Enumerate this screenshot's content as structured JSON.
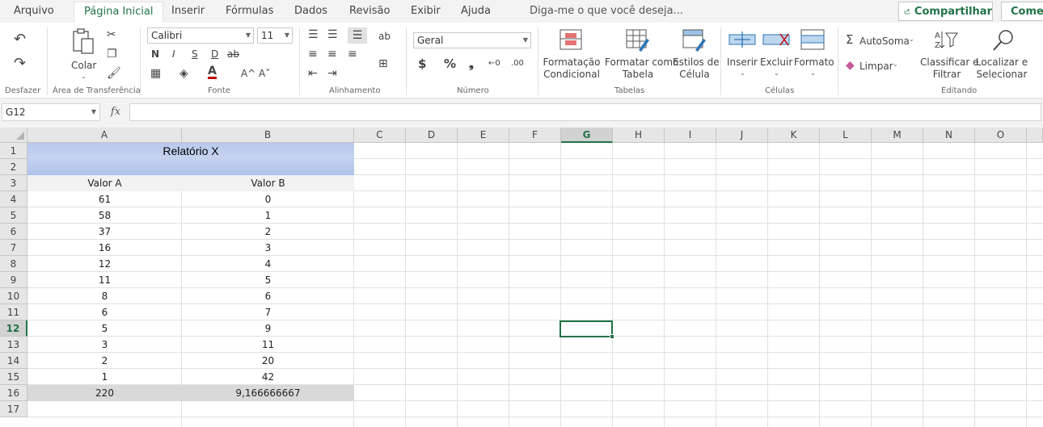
{
  "menu": {
    "tabs": [
      "Arquivo",
      "Página Inicial",
      "Inserir",
      "Fórmulas",
      "Dados",
      "Revisão",
      "Exibir",
      "Ajuda"
    ],
    "active_tab": "Página Inicial",
    "tell_me": "Diga-me o que você deseja...",
    "share": "Compartilhar",
    "comments": "Comentários"
  },
  "ribbon": {
    "undo_group": "Desfazer",
    "clipboard": {
      "paste": "Colar",
      "group": "Área de Transferência"
    },
    "font": {
      "name": "Calibri",
      "size": "11",
      "bold": "N",
      "italic": "I",
      "underline": "S",
      "double_underline": "D",
      "strike": "ab",
      "grow": "A^",
      "shrink": "A˅",
      "group": "Fonte"
    },
    "alignment": {
      "group": "Alinhamento"
    },
    "number": {
      "format": "Geral",
      "currency": "$",
      "percent": "%",
      "thousands": "❟",
      "group": "Número"
    },
    "styles": {
      "conditional": "Formatação Condicional",
      "conditional_l1": "Formatação",
      "conditional_l2": "Condicional",
      "table_l1": "Formatar como",
      "table_l2": "Tabela",
      "cell_l1": "Estilos de",
      "cell_l2": "Célula",
      "group": "Tabelas"
    },
    "cells": {
      "insert": "Inserir",
      "delete": "Excluir",
      "format": "Formato",
      "group": "Células"
    },
    "editing": {
      "autosum": "AutoSoma",
      "clear": "Limpar",
      "sort_l1": "Classificar e",
      "sort_l2": "Filtrar",
      "find_l1": "Localizar e",
      "find_l2": "Selecionar",
      "group": "Editando"
    }
  },
  "formula_bar": {
    "name_box": "G12",
    "fx": "fx",
    "formula": ""
  },
  "sheet": {
    "columns": [
      "A",
      "B",
      "C",
      "D",
      "E",
      "F",
      "G",
      "H",
      "I",
      "J",
      "K",
      "L",
      "M",
      "N",
      "O"
    ],
    "selected_column": "G",
    "rows": [
      "1",
      "2",
      "3",
      "4",
      "5",
      "6",
      "7",
      "8",
      "9",
      "10",
      "11",
      "12",
      "13",
      "14",
      "15",
      "16",
      "17"
    ],
    "selected_row": "12",
    "title": "Relatório X",
    "header_a": "Valor A",
    "header_b": "Valor B",
    "values_a": [
      "61",
      "58",
      "37",
      "16",
      "12",
      "11",
      "8",
      "6",
      "5",
      "3",
      "2",
      "1"
    ],
    "values_b": [
      "0",
      "1",
      "2",
      "3",
      "4",
      "5",
      "6",
      "7",
      "9",
      "11",
      "20",
      "42"
    ],
    "total_a": "220",
    "total_b": "9,166666667"
  }
}
